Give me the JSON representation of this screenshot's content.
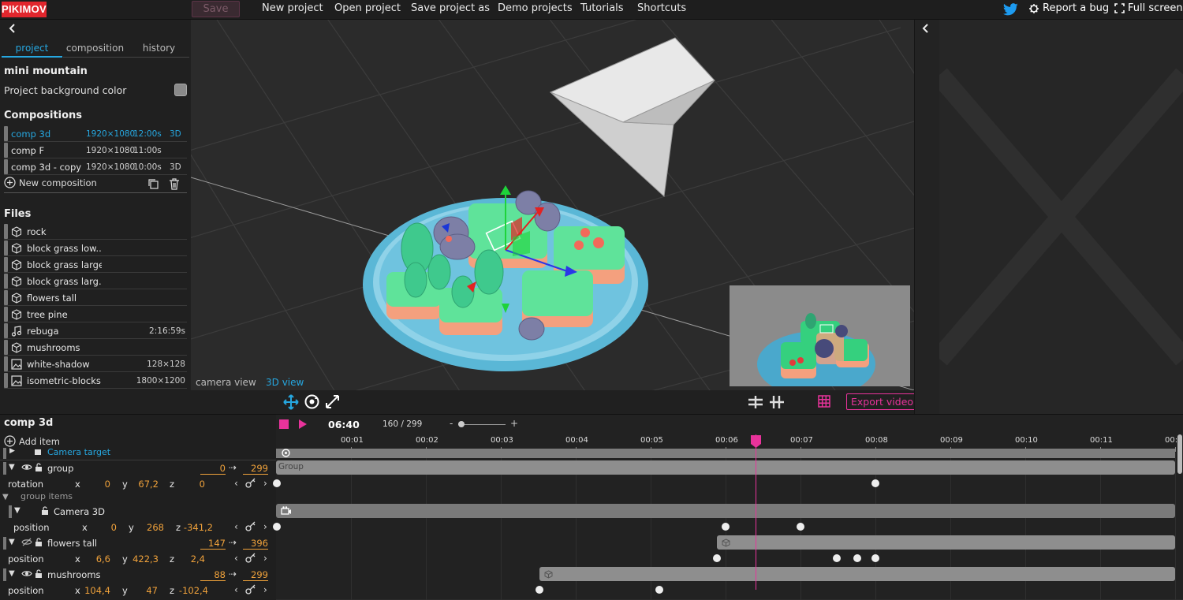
{
  "app": {
    "logo": "PIKIMOV",
    "save_label": "Save",
    "menu": [
      "New project",
      "Open project",
      "Save project as",
      "Demo projects",
      "Tutorials",
      "Shortcuts"
    ],
    "report_bug": "Report a bug",
    "full_screen": "Full screen"
  },
  "left_panel": {
    "tabs": [
      "project",
      "composition",
      "history"
    ],
    "active_tab": "project",
    "project_name": "mini mountain",
    "background_color_label": "Project background color",
    "compositions_title": "Compositions",
    "compositions": [
      {
        "name": "comp 3d",
        "res": "1920×1080",
        "duration": "12:00s",
        "mode": "3D",
        "active": true
      },
      {
        "name": "comp F",
        "res": "1920×1080",
        "duration": "11:00s",
        "mode": "",
        "active": false
      },
      {
        "name": "comp 3d - copy",
        "res": "1920×1080",
        "duration": "10:00s",
        "mode": "3D",
        "active": false
      }
    ],
    "new_composition": "New composition",
    "files_title": "Files",
    "files": [
      {
        "icon": "cube-icon",
        "name": "rock",
        "meta": ""
      },
      {
        "icon": "cube-icon",
        "name": "block grass low...",
        "meta": ""
      },
      {
        "icon": "cube-icon",
        "name": "block grass large",
        "meta": ""
      },
      {
        "icon": "cube-icon",
        "name": "block grass larg...",
        "meta": ""
      },
      {
        "icon": "cube-icon",
        "name": "flowers tall",
        "meta": ""
      },
      {
        "icon": "cube-icon",
        "name": "tree pine",
        "meta": ""
      },
      {
        "icon": "music-note-icon",
        "name": "rebuga",
        "meta": "2:16:59s"
      },
      {
        "icon": "cube-icon",
        "name": "mushrooms",
        "meta": ""
      },
      {
        "icon": "image-icon",
        "name": "white-shadow",
        "meta": "128×128"
      },
      {
        "icon": "image-icon",
        "name": "isometric-blocks",
        "meta": "1800×1200"
      }
    ]
  },
  "viewport": {
    "camera_view": "camera view",
    "view_3d": "3D view",
    "export_video": "Export video"
  },
  "timeline": {
    "comp_title": "comp 3d",
    "add_item": "Add item",
    "current_time": "06:40",
    "frame": "160 / 299",
    "zoom_minus": "-",
    "zoom_plus": "+",
    "ruler": [
      "00:01",
      "00:02",
      "00:03",
      "00:04",
      "00:05",
      "00:06",
      "00:07",
      "00:08",
      "00:09",
      "00:10",
      "00:11",
      "00:"
    ],
    "camera_target": "Camera target",
    "group": {
      "name": "group",
      "start": "0",
      "end": "299"
    },
    "rotation": {
      "label": "rotation",
      "x": "0",
      "y": "67,2",
      "z": "0"
    },
    "group_items": "group items",
    "camera3d": {
      "name": "Camera 3D"
    },
    "cam_position": {
      "label": "position",
      "x": "0",
      "y": "268",
      "z": "-341,2"
    },
    "flowers": {
      "name": "flowers tall",
      "start": "147",
      "end": "396"
    },
    "flowers_position": {
      "label": "position",
      "x": "6,6",
      "y": "422,3",
      "z": "2,4"
    },
    "mushrooms": {
      "name": "mushrooms",
      "start": "88",
      "end": "299"
    },
    "mushrooms_position": {
      "label": "position",
      "x": "104,4",
      "y": "47",
      "z": "-102,4"
    },
    "track_group_label": "Group",
    "axis_x": "x",
    "axis_y": "y",
    "axis_z": "z",
    "arrow": "⇢"
  },
  "colors": {
    "accent_blue": "#26a7e0",
    "accent_pink": "#e8339b",
    "value_orange": "#f0a23b"
  }
}
